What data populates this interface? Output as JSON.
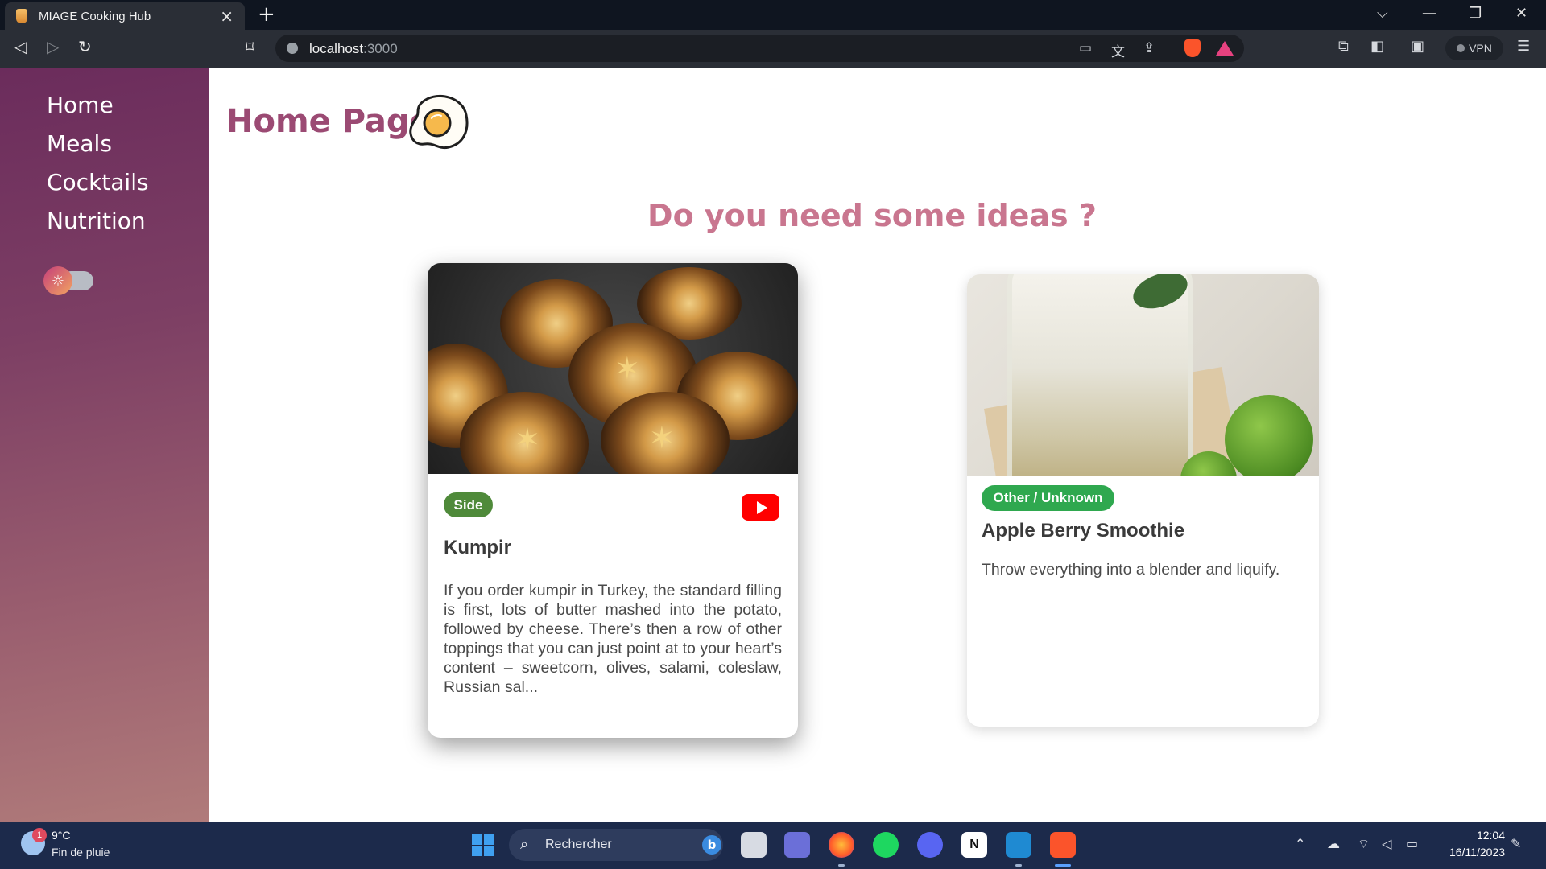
{
  "browser": {
    "tab_title": "MIAGE Cooking Hub",
    "tab_close": "×",
    "new_tab": "+",
    "url_host": "localhost",
    "url_port": ":3000",
    "vpn_label": "VPN"
  },
  "sidebar": {
    "items": [
      {
        "label": "Home"
      },
      {
        "label": "Meals"
      },
      {
        "label": "Cocktails"
      },
      {
        "label": "Nutrition"
      }
    ],
    "theme_toggle": {
      "icon": "sun-icon",
      "state": "light"
    }
  },
  "main": {
    "title": "Home Page",
    "subtitle": "Do you need some ideas ?",
    "cards": [
      {
        "badge": "Side",
        "badge_color": "#4f8a3a",
        "title": "Kumpir",
        "description": "If you order kumpir in Turkey, the standard filling is first, lots of butter mashed into the potato, followed by cheese. There’s then a row of other toppings that you can just point at to your heart’s content – sweetcorn, olives, salami, coleslaw, Russian sal...",
        "has_video": true,
        "video_icon": "youtube-icon"
      },
      {
        "badge": "Other / Unknown",
        "badge_color": "#2fa84f",
        "title": "Apple Berry Smoothie",
        "description": "Throw everything into a blender and liquify.",
        "has_video": false
      }
    ]
  },
  "taskbar": {
    "weather_temp": "9°C",
    "weather_desc": "Fin de pluie",
    "weather_alerts": "1",
    "search_placeholder": "Rechercher",
    "clock_time": "12:04",
    "clock_date": "16/11/2023"
  },
  "colors": {
    "accent_title": "#9b4a73",
    "accent_subtitle": "#c9768f",
    "sidebar_gradient": [
      "#6b2c5c",
      "#b07b7a"
    ]
  }
}
